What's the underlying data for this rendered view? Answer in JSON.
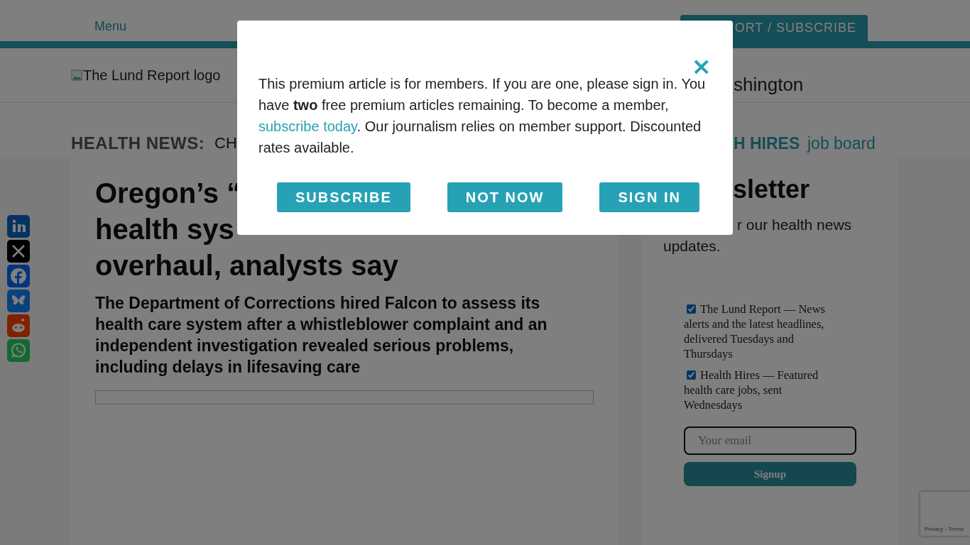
{
  "top_bar": {
    "menu": "Menu",
    "support_tab": "ORT / SUBSCRIBE"
  },
  "header": {
    "logo_alt": "The Lund Report logo",
    "region": "shington"
  },
  "nav": {
    "label": "HEALTH NEWS:",
    "topic": "CH",
    "hires": "H HIRES",
    "job_board": "job board"
  },
  "share": [
    {
      "kind": "linkedin"
    },
    {
      "kind": "x"
    },
    {
      "kind": "facebook"
    },
    {
      "kind": "bluesky"
    },
    {
      "kind": "reddit"
    },
    {
      "kind": "whatsapp"
    }
  ],
  "article": {
    "headline": [
      "Oregon’s “",
      "health sys",
      "overhaul, analysts say"
    ],
    "dek": "The Department of Corrections hired Falcon to assess its health care system after a whistleblower complaint and an independent investigation revealed serious problems, including delays in lifesaving care"
  },
  "newsletter": {
    "title": "sletter",
    "intro": "r our health news updates.",
    "options": [
      {
        "label": "The Lund Report — News alerts and the latest headlines, delivered Tuesdays and Thursdays",
        "checked": true
      },
      {
        "label": "Health Hires — Featured health care jobs, sent Wednesdays",
        "checked": true
      }
    ],
    "email": {
      "placeholder": "Your email"
    },
    "signup": "Signup"
  },
  "recaptcha": "Privacy - Terms",
  "modal": {
    "close": "×",
    "text_before": "This premium article is for members. If you are one, please sign in. You have **two** free premium articles remaining. To become a member, ",
    "link": "subscribe today",
    "text_after": ". Our journalism relies on member support. Discounted rates available.",
    "buttons": [
      "SUBSCRIBE",
      "NOT NOW",
      "SIGN IN"
    ]
  }
}
